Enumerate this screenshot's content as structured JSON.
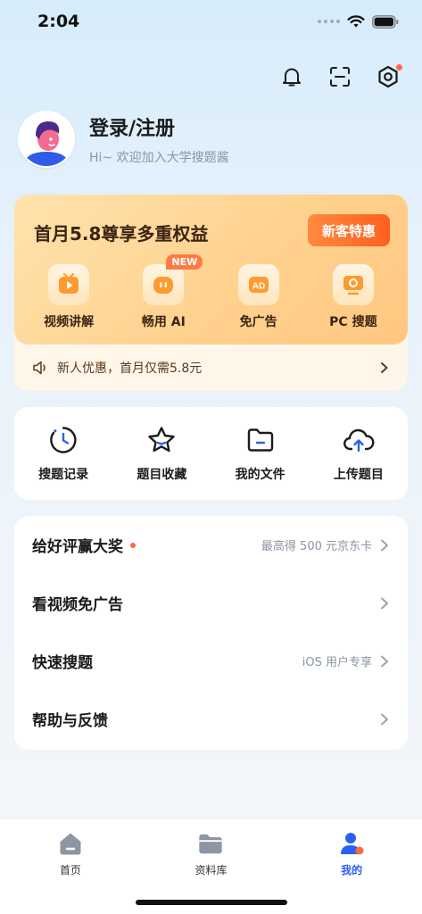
{
  "status": {
    "time": "2:04"
  },
  "profile": {
    "login_title": "登录/注册",
    "subtitle": "Hi~ 欢迎加入大学搜题酱"
  },
  "vip": {
    "title": "首月5.8尊享多重权益",
    "button": "新客特惠",
    "benefits": [
      {
        "label": "视频讲解",
        "icon": "video-play-icon"
      },
      {
        "label": "畅用 AI",
        "icon": "ai-robot-icon",
        "badge": "NEW"
      },
      {
        "label": "免广告",
        "icon": "ad-icon",
        "icon_text": "AD"
      },
      {
        "label": "PC 搜题",
        "icon": "pc-monitor-icon"
      }
    ],
    "notice": "新人优惠，首月仅需5.8元"
  },
  "tools": [
    {
      "label": "搜题记录",
      "icon": "history-clock-icon"
    },
    {
      "label": "题目收藏",
      "icon": "star-icon"
    },
    {
      "label": "我的文件",
      "icon": "folder-icon"
    },
    {
      "label": "上传题目",
      "icon": "cloud-upload-icon"
    }
  ],
  "menu": [
    {
      "title": "给好评赢大奖",
      "hint": "最高得 500 元京东卡",
      "dot": true
    },
    {
      "title": "看视频免广告",
      "hint": ""
    },
    {
      "title": "快速搜题",
      "hint": "iOS 用户专享"
    },
    {
      "title": "帮助与反馈",
      "hint": ""
    }
  ],
  "tabs": [
    {
      "label": "首页",
      "icon": "home-icon",
      "active": false
    },
    {
      "label": "资料库",
      "icon": "library-folder-icon",
      "active": false
    },
    {
      "label": "我的",
      "icon": "user-profile-icon",
      "active": true
    }
  ],
  "colors": {
    "accent": "#2b5ff5",
    "vip_button": "#ff6a2a",
    "badge": "#ff7a45"
  }
}
